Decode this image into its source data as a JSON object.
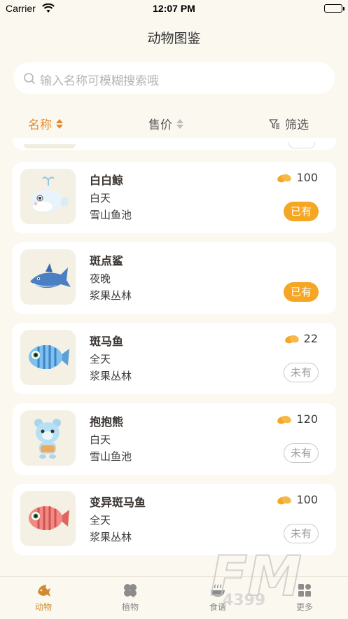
{
  "status_bar": {
    "carrier": "Carrier",
    "time": "12:07 PM"
  },
  "page": {
    "title": "动物图鉴"
  },
  "search": {
    "placeholder": "输入名称可模糊搜索哦"
  },
  "sort_bar": {
    "name_label": "名称",
    "price_label": "售价",
    "filter_label": "筛选"
  },
  "animals": [
    {
      "name": "白白鲸",
      "time": "白天",
      "location": "雪山鱼池",
      "price": "100",
      "status": "已有",
      "owned": true,
      "icon": "white-whale"
    },
    {
      "name": "斑点鲨",
      "time": "夜晚",
      "location": "浆果丛林",
      "price": "",
      "status": "已有",
      "owned": true,
      "icon": "spotted-shark"
    },
    {
      "name": "斑马鱼",
      "time": "全天",
      "location": "浆果丛林",
      "price": "22",
      "status": "未有",
      "owned": false,
      "icon": "zebra-fish"
    },
    {
      "name": "抱抱熊",
      "time": "白天",
      "location": "雪山鱼池",
      "price": "120",
      "status": "未有",
      "owned": false,
      "icon": "hug-bear"
    },
    {
      "name": "变异斑马鱼",
      "time": "全天",
      "location": "浆果丛林",
      "price": "100",
      "status": "未有",
      "owned": false,
      "icon": "mutant-zebra-fish"
    }
  ],
  "tabs": [
    {
      "label": "动物",
      "icon": "fish-icon",
      "active": true
    },
    {
      "label": "植物",
      "icon": "clover-icon",
      "active": false
    },
    {
      "label": "食谱",
      "icon": "bowl-icon",
      "active": false
    },
    {
      "label": "更多",
      "icon": "grid-icon",
      "active": false
    }
  ],
  "colors": {
    "accent": "#e58a2b",
    "owned_pill": "#f5a623",
    "background": "#fbf8f0"
  }
}
